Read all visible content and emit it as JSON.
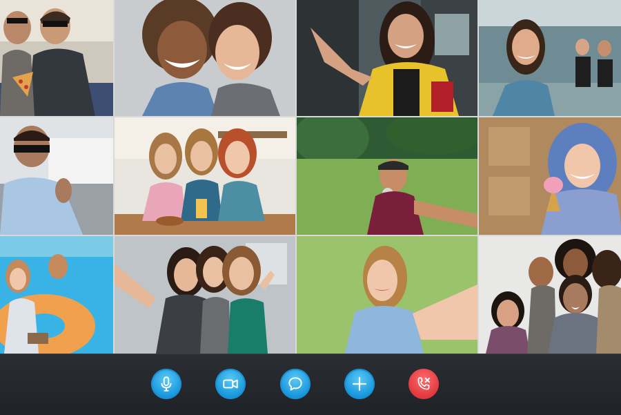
{
  "call": {
    "participants_visible": 12
  },
  "toolbar": {
    "buttons": [
      {
        "id": "mic",
        "icon": "microphone-icon"
      },
      {
        "id": "camera",
        "icon": "video-camera-icon"
      },
      {
        "id": "chat",
        "icon": "chat-bubble-icon"
      },
      {
        "id": "add",
        "icon": "plus-icon"
      },
      {
        "id": "end",
        "icon": "end-call-icon"
      }
    ]
  },
  "colors": {
    "accent": "#1596dc",
    "end_call": "#e0393f",
    "toolbar_bg": "#26292e"
  }
}
